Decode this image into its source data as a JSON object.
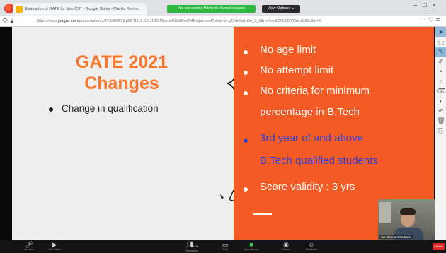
{
  "browser": {
    "tab_title": "Evaluation of GATE for Non-CST - Google Slides - Mozilla Firefox",
    "share_banner": "You are viewing Mahendra Kumar's screen",
    "view_options": "View Options ⌄",
    "address_prefix": "https://docs.",
    "address_domain": "google.com",
    "address_rest": "/presentation/d/1YAGN8Jfj2p2ETLhJLKZUT3SfMkwneRbNGhx/N4Ba/present?slide=id.g22de9a1d5b_0_0&rm=mr&OfE3IGVCAnGdGs9&f=0"
  },
  "slide": {
    "title_line1": "GATE 2021",
    "title_line2": "Changes",
    "left_bullet": "Change in qualification",
    "right_items": [
      "No age limit",
      "No attempt limit",
      "No criteria for minimum",
      "percentage in B.Tech",
      "3rd year of and above",
      "B.Tech qualified students",
      "Score validity : 3 yrs"
    ]
  },
  "webcam": {
    "name": "Sai Gannu Kiranbabu"
  },
  "zoom_toolbar": {
    "items": [
      {
        "icon": "microphone-icon",
        "label": "Unmute"
      },
      {
        "icon": "video-icon",
        "label": "Start Video"
      },
      {
        "icon": "participants-icon",
        "label": "Participants"
      },
      {
        "icon": "chat-icon",
        "label": "Chat"
      },
      {
        "icon": "share-screen-icon",
        "label": "Share Screen"
      },
      {
        "icon": "record-icon",
        "label": "Record"
      },
      {
        "icon": "reactions-icon",
        "label": "Reactions"
      }
    ],
    "participant_count": "23",
    "end_label": "Leave"
  },
  "colors": {
    "slide_accent": "#f25c24",
    "title_orange": "#f5782e",
    "highlight_blue": "#2d3ed9",
    "zoom_green": "#2db83d"
  }
}
